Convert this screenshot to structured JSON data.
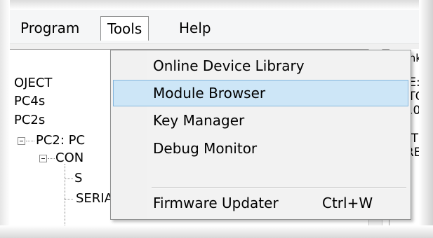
{
  "menubar": {
    "items": [
      {
        "label": "Program"
      },
      {
        "label": "Tools"
      },
      {
        "label": "Help"
      }
    ]
  },
  "tools_menu": {
    "items": [
      {
        "label": "Online Device Library",
        "shortcut": ""
      },
      {
        "label": "Module Browser",
        "shortcut": "",
        "highlighted": true
      },
      {
        "label": "Key Manager",
        "shortcut": ""
      },
      {
        "label": "Debug Monitor",
        "shortcut": ""
      },
      {
        "label": "Firmware Updater",
        "shortcut": "Ctrl+W"
      }
    ]
  },
  "tree": {
    "rows": [
      {
        "text": "OJECT"
      },
      {
        "text": "PC4s"
      },
      {
        "text": "PC2s"
      },
      {
        "text": "PC2: PC"
      },
      {
        "text": "CON"
      },
      {
        "text": "S"
      },
      {
        "text": "SERIALPORT2"
      }
    ]
  },
  "properties": {
    "header": "oolink",
    "lines": [
      "AME:",
      "ROTO",
      "0.0.0",
      "RT:",
      "INCT",
      "XPRE"
    ]
  },
  "colors": {
    "highlight_bg": "#cde6f7",
    "highlight_border": "#84b6dd",
    "menu_bg": "#f2f2f2"
  }
}
